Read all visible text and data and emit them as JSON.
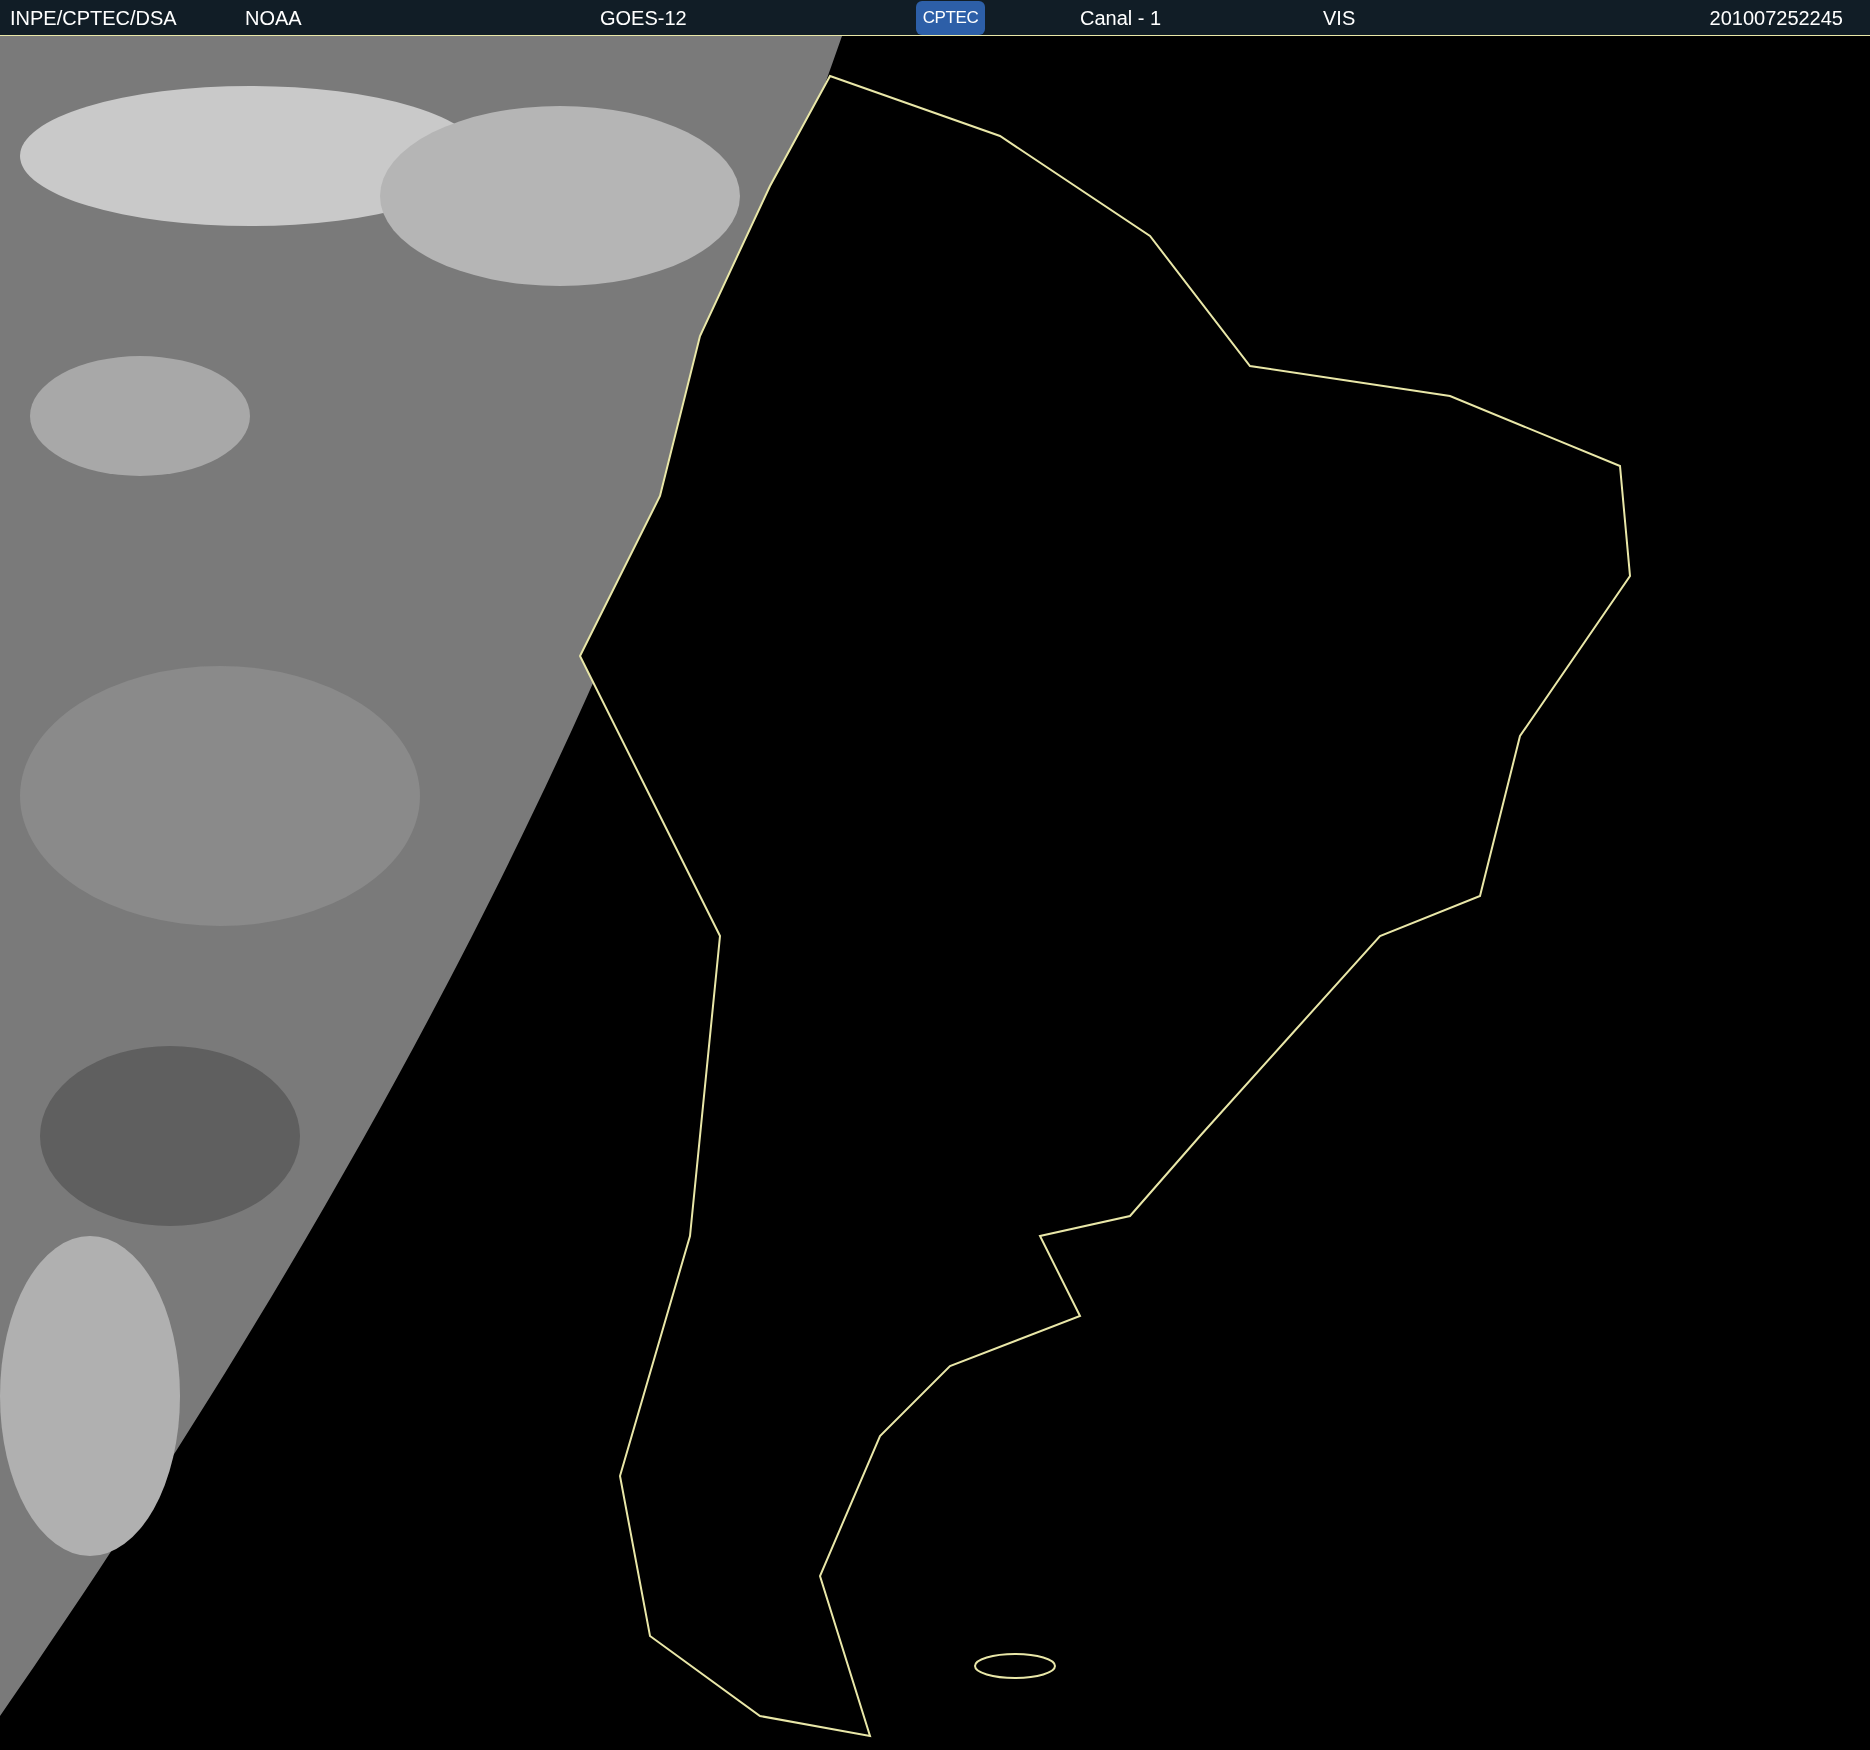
{
  "header": {
    "source": "INPE/CPTEC/DSA",
    "agency": "NOAA",
    "satellite": "GOES-12",
    "logo_text": "CPTEC",
    "channel": "Canal - 1",
    "band": "VIS",
    "timestamp": "201007252245"
  }
}
